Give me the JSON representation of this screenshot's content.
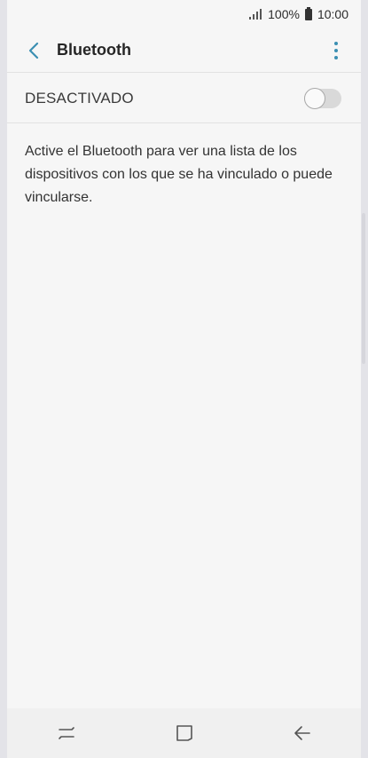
{
  "status_bar": {
    "battery_percent": "100%",
    "time": "10:00",
    "icons": [
      "signal-icon",
      "battery-icon"
    ]
  },
  "header": {
    "title": "Bluetooth",
    "back_icon": "back-chevron-icon",
    "more_icon": "more-vertical-icon",
    "accent_color": "#3b8fb2"
  },
  "bluetooth_toggle": {
    "label": "DESACTIVADO",
    "state": "off"
  },
  "description": "Active el Bluetooth para ver una lista de los dispositivos con los que se ha vinculado o puede vincularse.",
  "nav_bar": {
    "icons": [
      "recent-apps-icon",
      "home-icon",
      "back-arrow-icon"
    ]
  }
}
